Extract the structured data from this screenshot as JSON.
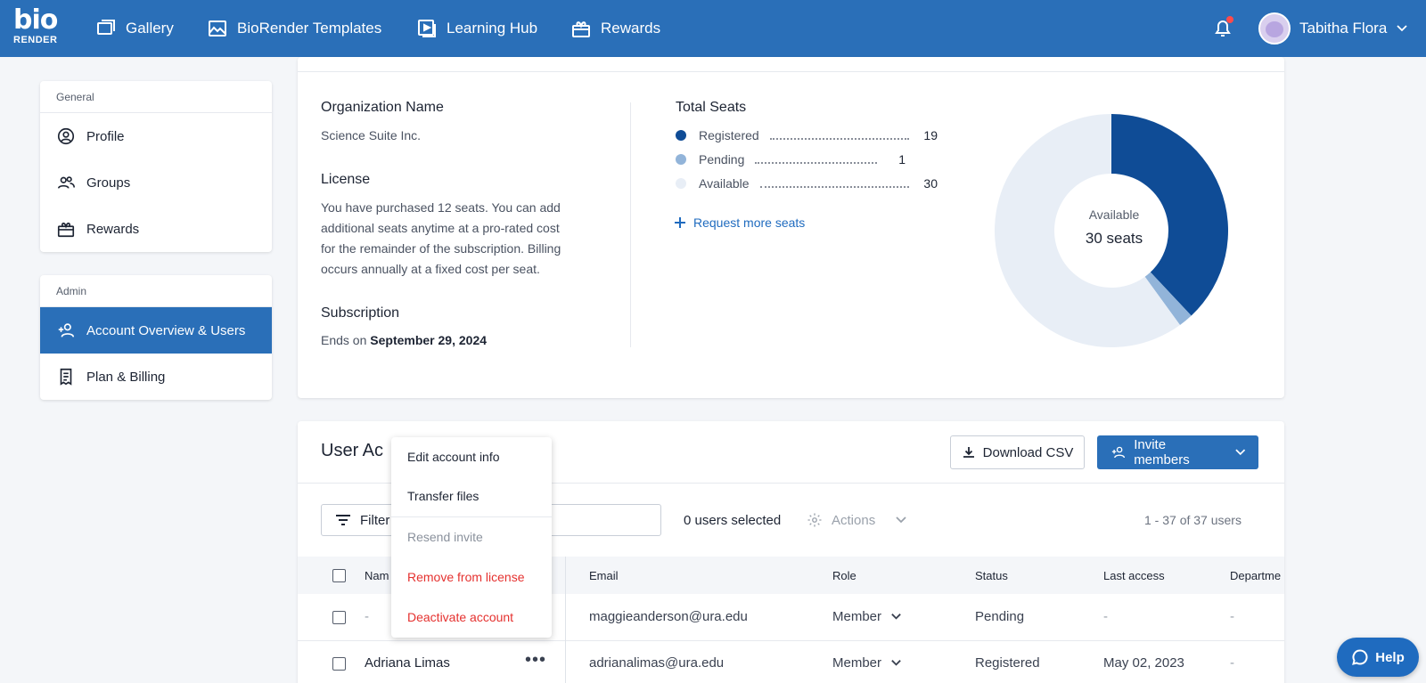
{
  "logo": {
    "top": "bio",
    "bottom": "RENDER"
  },
  "nav": {
    "items": [
      {
        "label": "Gallery",
        "icon": "gallery-icon"
      },
      {
        "label": "BioRender Templates",
        "icon": "image-icon"
      },
      {
        "label": "Learning Hub",
        "icon": "play-icon"
      },
      {
        "label": "Rewards",
        "icon": "gift-icon"
      }
    ],
    "user_name": "Tabitha Flora"
  },
  "sidebar": {
    "general_header": "General",
    "general_items": [
      {
        "label": "Profile",
        "icon": "user-circle-icon"
      },
      {
        "label": "Groups",
        "icon": "group-icon"
      },
      {
        "label": "Rewards",
        "icon": "gift-icon"
      }
    ],
    "admin_header": "Admin",
    "admin_items": [
      {
        "label": "Account Overview & Users",
        "icon": "add-user-icon",
        "active": true
      },
      {
        "label": "Plan & Billing",
        "icon": "receipt-icon"
      }
    ]
  },
  "org": {
    "name_label": "Organization Name",
    "name_value": "Science Suite Inc.",
    "license_label": "License",
    "license_text_1": "You have purchased 12 seats. You can add",
    "license_text_2": "additional seats anytime at a pro-rated cost",
    "license_text_3": "for the remainder of the subscription. Billing",
    "license_text_4": "occurs annually at a fixed cost per seat.",
    "subscription_label": "Subscription",
    "subscription_prefix": "Ends on",
    "subscription_date": "September 29, 2024"
  },
  "seats": {
    "title": "Total Seats",
    "rows": [
      {
        "label": "Registered",
        "value": "19",
        "color": "#0f4c96"
      },
      {
        "label": "Pending",
        "value": "1",
        "color": "#92b4d9"
      },
      {
        "label": "Available",
        "value": "30",
        "color": "#e8eef6"
      }
    ],
    "request_label": "Request more seats",
    "donut_caption": "Available",
    "donut_value": "30 seats"
  },
  "chart_data": {
    "type": "pie",
    "categories": [
      "Registered",
      "Pending",
      "Available"
    ],
    "values": [
      19,
      1,
      30
    ],
    "colors": [
      "#0f4c96",
      "#92b4d9",
      "#e8eef6"
    ]
  },
  "users": {
    "title_visible": "User Ac",
    "download_label": "Download CSV",
    "invite_label": "Invite members",
    "filter_label": "Filter",
    "selected_text": "0 users selected",
    "actions_label": "Actions",
    "count_text": "1 - 37 of 37 users",
    "columns": {
      "name": "Nam",
      "email": "Email",
      "role": "Role",
      "status": "Status",
      "last_access": "Last access",
      "department": "Departme"
    },
    "rows": [
      {
        "name": "-",
        "email": "maggieanderson@ura.edu",
        "role": "Member",
        "status": "Pending",
        "last_access": "-",
        "department": "-"
      },
      {
        "name": "Adriana Limas",
        "email": "adrianalimas@ura.edu",
        "role": "Member",
        "status": "Registered",
        "last_access": "May 02, 2023",
        "department": "-"
      }
    ]
  },
  "menu": {
    "edit": "Edit account info",
    "transfer": "Transfer files",
    "resend": "Resend invite",
    "remove": "Remove from license",
    "deactivate": "Deactivate account"
  },
  "help_label": "Help"
}
